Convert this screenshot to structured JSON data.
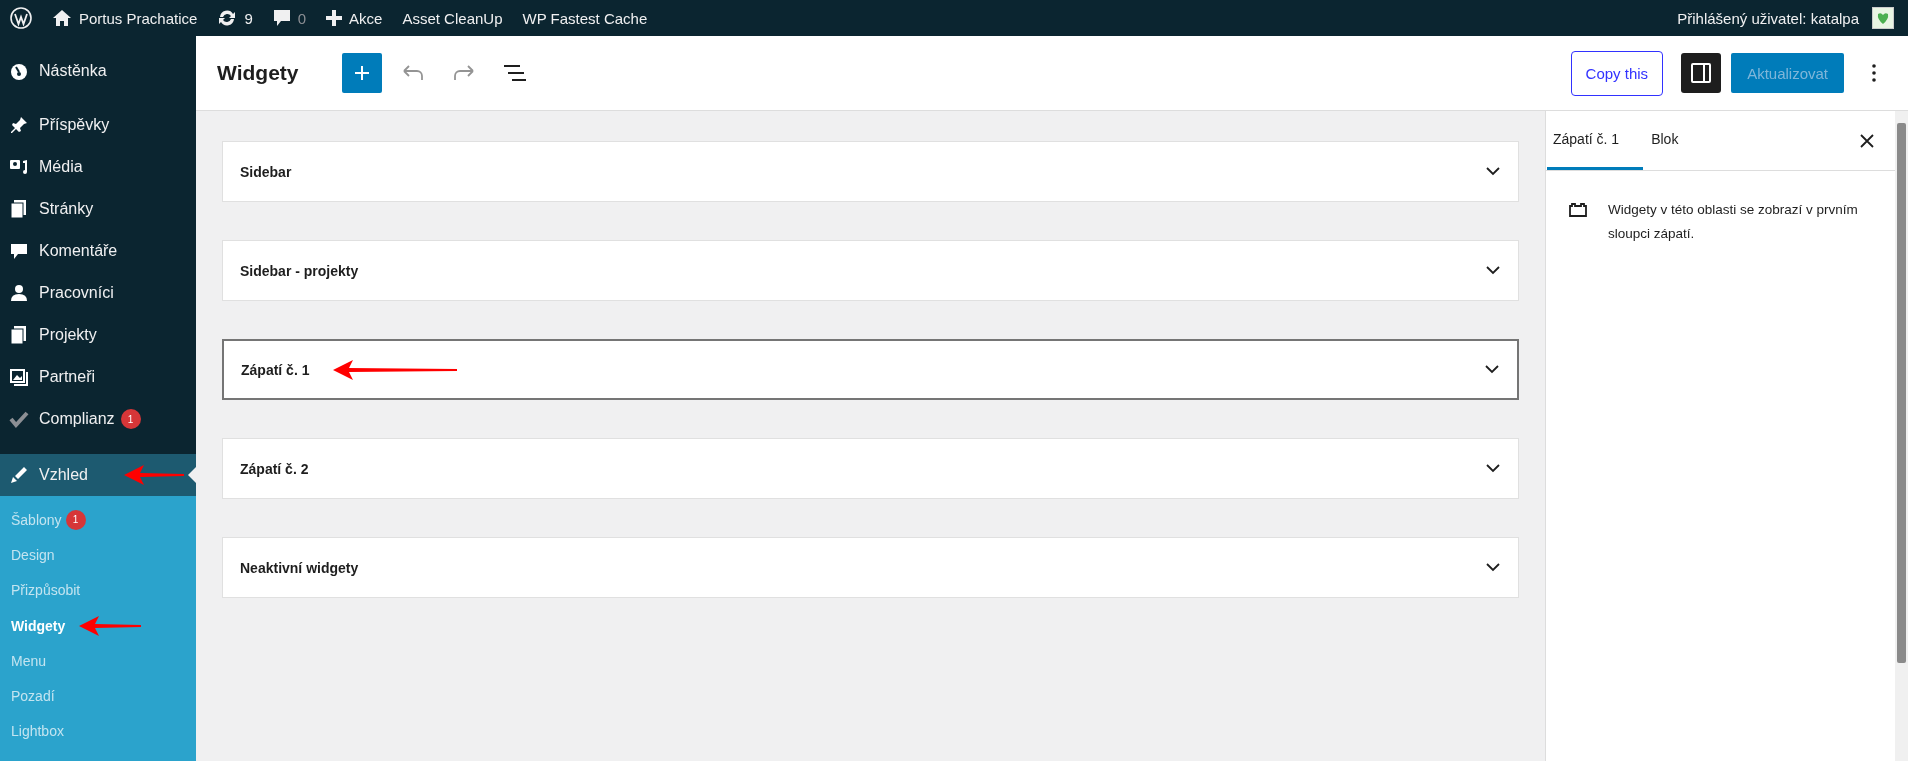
{
  "admin_bar": {
    "site_name": "Portus Prachatice",
    "updates_count": "9",
    "comments_count": "0",
    "new_label": "Akce",
    "links": [
      "Asset CleanUp",
      "WP Fastest Cache"
    ],
    "user_greeting": "Přihlášený uživatel: katalpa"
  },
  "sidebar": {
    "items": [
      {
        "label": "Nástěnka",
        "selected": false,
        "arrow": false
      },
      {
        "label": "Příspěvky",
        "selected": false,
        "arrow": false
      },
      {
        "label": "Média",
        "selected": false,
        "arrow": false
      },
      {
        "label": "Stránky",
        "selected": false,
        "arrow": false
      },
      {
        "label": "Komentáře",
        "selected": false,
        "arrow": false
      },
      {
        "label": "Pracovníci",
        "selected": false,
        "arrow": false
      },
      {
        "label": "Projekty",
        "selected": false,
        "arrow": false
      },
      {
        "label": "Partneři",
        "selected": false,
        "arrow": false
      },
      {
        "label": "Complianz",
        "selected": false,
        "arrow": false,
        "badge": "1"
      },
      {
        "label": "Vzhled",
        "selected": true,
        "arrow": true,
        "children": [
          {
            "label": "Šablony",
            "selected": false,
            "arrow": false,
            "badge": "1"
          },
          {
            "label": "Design",
            "selected": false,
            "arrow": false
          },
          {
            "label": "Přizpůsobit",
            "selected": false,
            "arrow": false
          },
          {
            "label": "Widgety",
            "selected": true,
            "arrow": true
          },
          {
            "label": "Menu",
            "selected": false,
            "arrow": false
          },
          {
            "label": "Pozadí",
            "selected": false,
            "arrow": false
          },
          {
            "label": "Lightbox",
            "selected": false,
            "arrow": false
          }
        ]
      }
    ]
  },
  "header": {
    "title": "Widgety",
    "copy_button": "Copy this",
    "update_button": {
      "label": "Aktualizovat",
      "disabled": true
    },
    "settings_open": true
  },
  "widget_areas": [
    {
      "title": "Sidebar",
      "selected": false,
      "arrow": false
    },
    {
      "title": "Sidebar - projekty",
      "selected": false,
      "arrow": false
    },
    {
      "title": "Zápatí č. 1",
      "selected": true,
      "arrow": true
    },
    {
      "title": "Zápatí č. 2",
      "selected": false,
      "arrow": false
    },
    {
      "title": "Neaktivní widgety",
      "selected": false,
      "arrow": false
    }
  ],
  "settings_panel": {
    "tabs": [
      {
        "label": "Zápatí č. 1",
        "selected": true
      },
      {
        "label": "Blok",
        "selected": false
      }
    ],
    "description": "Widgety v této oblasti se zobrazí v prvním sloupci zápatí."
  }
}
